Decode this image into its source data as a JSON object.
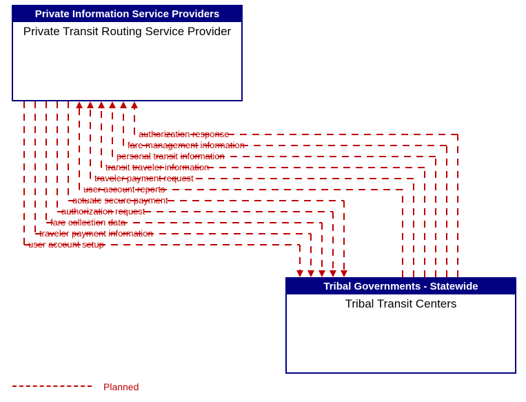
{
  "top_box": {
    "header": "Private Information Service Providers",
    "body": "Private Transit Routing Service Provider"
  },
  "bottom_box": {
    "header": "Tribal Governments - Statewide",
    "body": "Tribal Transit Centers"
  },
  "flows_down": [
    "user account setup",
    "traveler payment information",
    "fare collection data",
    "authorization request",
    "actuate secure payment"
  ],
  "flows_up": [
    "user account reports",
    "traveler payment request",
    "transit traveler information",
    "personal transit information",
    "fare management information",
    "authorization response"
  ],
  "legend": "Planned"
}
